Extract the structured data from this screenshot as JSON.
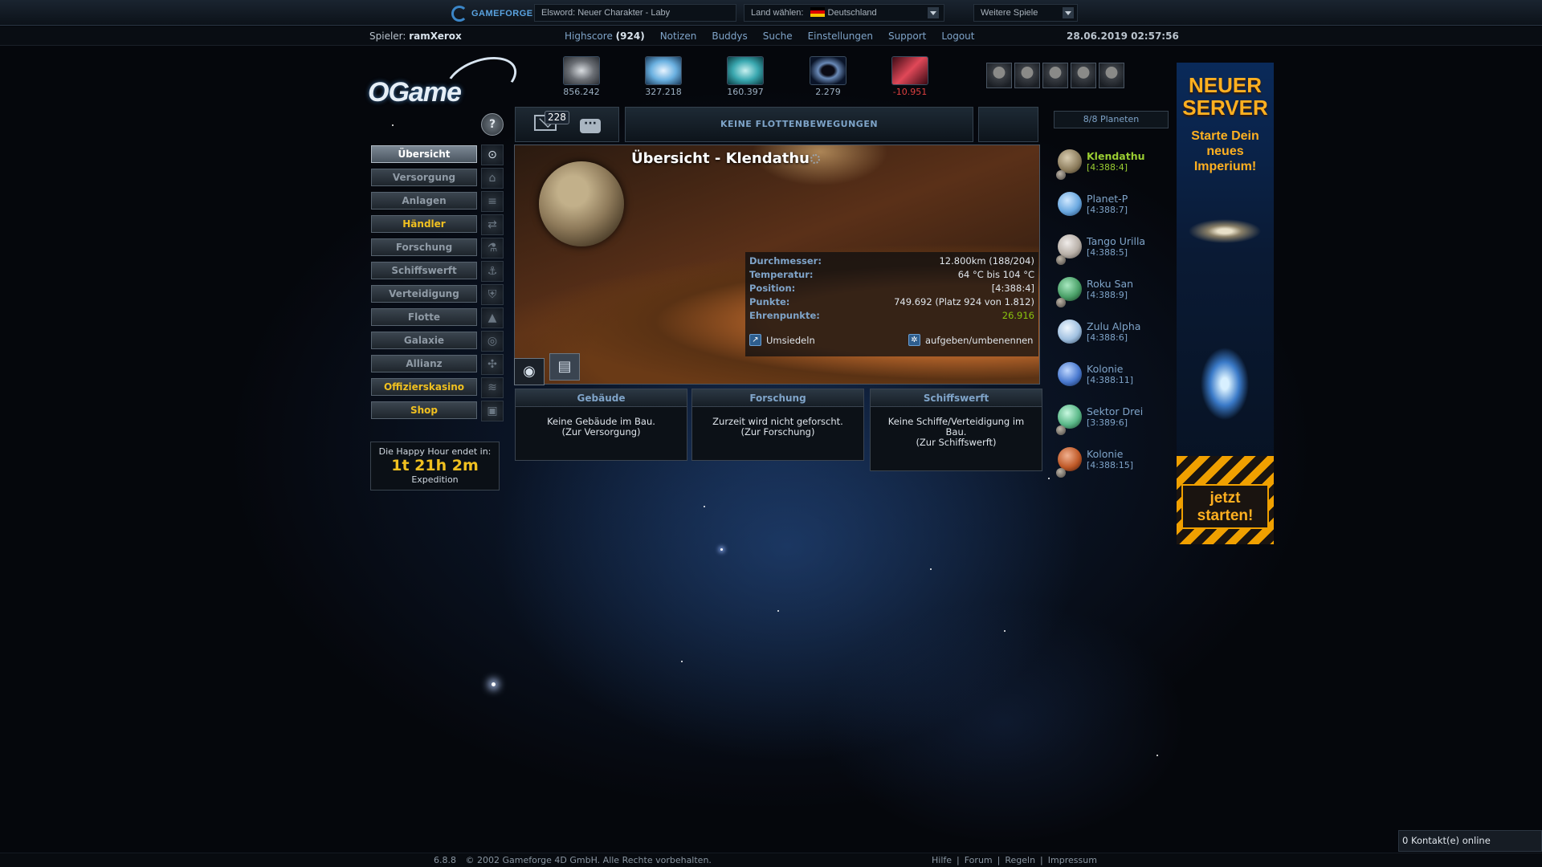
{
  "gameforge": {
    "logo_text": "GAMEFORGE",
    "news_text": "Elsword: Neuer Charakter - Laby",
    "country_label": "Land wählen:",
    "country_value": "Deutschland",
    "more_games": "Weitere Spiele"
  },
  "playerbar": {
    "player_label": "Spieler:",
    "player_name": "ramXerox",
    "links": [
      "Highscore",
      "Notizen",
      "Buddys",
      "Suche",
      "Einstellungen",
      "Support",
      "Logout"
    ],
    "highscore_rank": "(924)",
    "datetime": "28.06.2019 02:57:56"
  },
  "logo_text": "OGame",
  "resources": [
    {
      "name": "metal",
      "value": "856.242",
      "negative": false,
      "color": "#8a8f96"
    },
    {
      "name": "crystal",
      "value": "327.218",
      "negative": false,
      "color": "#6ab0e0"
    },
    {
      "name": "deuterium",
      "value": "160.397",
      "negative": false,
      "color": "#3aa8b0"
    },
    {
      "name": "dark-matter",
      "value": "2.279",
      "negative": false,
      "color": "#2a3a60"
    },
    {
      "name": "energy",
      "value": "-10.951",
      "negative": true,
      "color": "#c04050"
    }
  ],
  "help_glyph": "?",
  "menu": [
    {
      "label": "Übersicht",
      "style": "active",
      "icon": "⊙"
    },
    {
      "label": "Versorgung",
      "style": "normal",
      "icon": "⌂"
    },
    {
      "label": "Anlagen",
      "style": "normal",
      "icon": "≡"
    },
    {
      "label": "Händler",
      "style": "gold",
      "icon": "⇄"
    },
    {
      "label": "Forschung",
      "style": "normal",
      "icon": "⚗"
    },
    {
      "label": "Schiffswerft",
      "style": "normal",
      "icon": "⚓"
    },
    {
      "label": "Verteidigung",
      "style": "normal",
      "icon": "⛨"
    },
    {
      "label": "Flotte",
      "style": "normal",
      "icon": "▲"
    },
    {
      "label": "Galaxie",
      "style": "normal",
      "icon": "◎"
    },
    {
      "label": "Allianz",
      "style": "normal",
      "icon": "✣"
    },
    {
      "label": "Offizierskasino",
      "style": "gold",
      "icon": "≋"
    },
    {
      "label": "Shop",
      "style": "gold",
      "icon": "▣"
    }
  ],
  "happy_hour": {
    "title": "Die Happy Hour endet in:",
    "time": "1t 21h 2m",
    "type": "Expedition"
  },
  "messages": {
    "count": "228"
  },
  "fleet_status": "KEINE FLOTTENBEWEGUNGEN",
  "overview": {
    "title": "Übersicht - Klendathu",
    "info": [
      {
        "label": "Durchmesser:",
        "value": "12.800km (188/204)",
        "highlight": false
      },
      {
        "label": "Temperatur:",
        "value": "64 °C bis 104 °C",
        "highlight": false
      },
      {
        "label": "Position:",
        "value": "[4:388:4]",
        "highlight": false
      },
      {
        "label": "Punkte:",
        "value": "749.692 (Platz 924 von 1.812)",
        "highlight": false
      },
      {
        "label": "Ehrenpunkte:",
        "value": "26.916",
        "highlight": true
      }
    ],
    "action_relocate": "Umsiedeln",
    "action_abandon": "aufgeben/umbenennen"
  },
  "production": [
    {
      "title": "Gebäude",
      "text": "Keine Gebäude im Bau.",
      "link": "(Zur Versorgung)"
    },
    {
      "title": "Forschung",
      "text": "Zurzeit wird nicht geforscht.",
      "link": "(Zur Forschung)"
    },
    {
      "title": "Schiffswerft",
      "text": "Keine Schiffe/Verteidigung im Bau.",
      "link": "(Zur Schiffswerft)"
    }
  ],
  "planets": {
    "count_label": "8/8 Planeten",
    "list": [
      {
        "name": "Klendathu",
        "coords": "[4:388:4]",
        "selected": true,
        "moon": true,
        "color": "#b8a888"
      },
      {
        "name": "Planet-P",
        "coords": "[4:388:7]",
        "selected": false,
        "moon": false,
        "color": "#6aa8e0"
      },
      {
        "name": "Tango Urilla",
        "coords": "[4:388:5]",
        "selected": false,
        "moon": true,
        "color": "#c8c0b8"
      },
      {
        "name": "Roku San",
        "coords": "[4:388:9]",
        "selected": false,
        "moon": true,
        "color": "#5ab070"
      },
      {
        "name": "Zulu Alpha",
        "coords": "[4:388:6]",
        "selected": false,
        "moon": false,
        "color": "#a8c8e8"
      },
      {
        "name": "Kolonie",
        "coords": "[4:388:11]",
        "selected": false,
        "moon": false,
        "color": "#5a8ad8"
      },
      {
        "name": "Sektor Drei",
        "coords": "[3:389:6]",
        "selected": false,
        "moon": true,
        "color": "#6ac890"
      },
      {
        "name": "Kolonie",
        "coords": "[4:388:15]",
        "selected": false,
        "moon": true,
        "color": "#c86a38"
      }
    ]
  },
  "ad": {
    "headline_1": "NEUER",
    "headline_2": "SERVER",
    "sub_1": "Starte Dein",
    "sub_2": "neues",
    "sub_3": "Imperium!",
    "cta_1": "jetzt",
    "cta_2": "starten!"
  },
  "footer": {
    "version": "6.8.8",
    "copyright": "© 2002 Gameforge 4D GmbH. Alle Rechte vorbehalten.",
    "links": [
      "Hilfe",
      "Forum",
      "Regeln",
      "Impressum"
    ]
  },
  "contacts_online": "0 Kontakt(e) online"
}
